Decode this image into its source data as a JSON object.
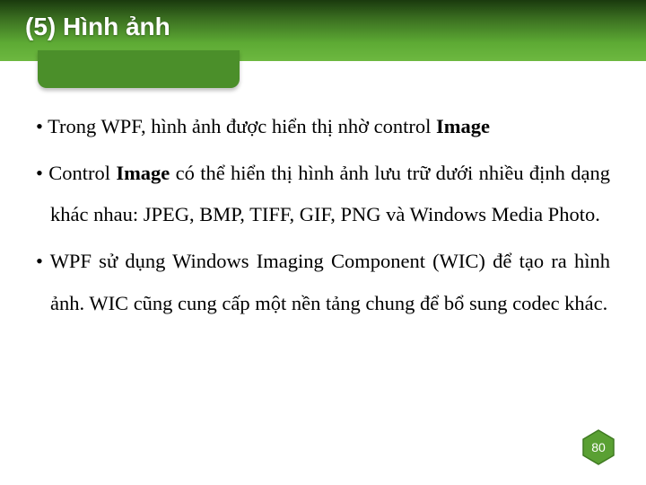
{
  "header": {
    "title": "(5) Hình ảnh"
  },
  "content": {
    "bullets": [
      {
        "pre": "• Trong WPF, hình ảnh được hiển thị nhờ control ",
        "bold": "Image",
        "post": ""
      },
      {
        "pre": "• Control ",
        "bold": "Image",
        "post": " có thể hiển thị hình ảnh lưu trữ dưới nhiều định dạng khác nhau: JPEG, BMP, TIFF, GIF, PNG và Windows Media Photo."
      },
      {
        "pre": "• WPF sử dụng Windows Imaging Component (WIC) để tạo ra hình ảnh. WIC cũng cung cấp một nền tảng chung để bổ sung codec khác.",
        "bold": "",
        "post": ""
      }
    ]
  },
  "footer": {
    "page": "80"
  },
  "colors": {
    "accent": "#5daa34"
  }
}
